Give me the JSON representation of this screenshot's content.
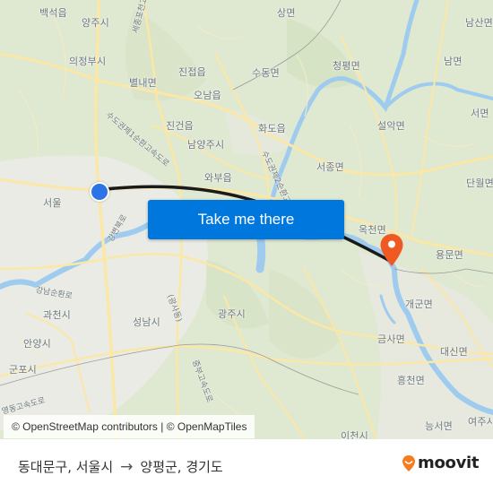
{
  "map": {
    "places": [
      {
        "name": "백석읍"
      },
      {
        "name": "양주시"
      },
      {
        "name": "의정부시"
      },
      {
        "name": "별내면"
      },
      {
        "name": "진접읍"
      },
      {
        "name": "오남읍"
      },
      {
        "name": "진건읍"
      },
      {
        "name": "남양주시"
      },
      {
        "name": "와부읍"
      },
      {
        "name": "서울"
      },
      {
        "name": "상면"
      },
      {
        "name": "수동면"
      },
      {
        "name": "청평면"
      },
      {
        "name": "남산면"
      },
      {
        "name": "남면"
      },
      {
        "name": "설악면"
      },
      {
        "name": "서면"
      },
      {
        "name": "화도읍"
      },
      {
        "name": "서종면"
      },
      {
        "name": "단월면"
      },
      {
        "name": "옥천면"
      },
      {
        "name": "용문면"
      },
      {
        "name": "개군면"
      },
      {
        "name": "금사면"
      },
      {
        "name": "대신면"
      },
      {
        "name": "흥천면"
      },
      {
        "name": "여주시"
      },
      {
        "name": "능서면"
      },
      {
        "name": "이천시"
      },
      {
        "name": "광주시"
      },
      {
        "name": "성남시"
      },
      {
        "name": "과천시"
      },
      {
        "name": "안양시"
      },
      {
        "name": "군포시"
      }
    ],
    "road_labels": [
      {
        "name": "세종포천고속도로"
      },
      {
        "name": "수도권제1순환고속도로"
      },
      {
        "name": "수도권제2순환고속도로"
      },
      {
        "name": "강남순환로"
      },
      {
        "name": "(광사동)"
      },
      {
        "name": "중부고속도로"
      },
      {
        "name": "영동고속도로"
      },
      {
        "name": "강변북로"
      }
    ],
    "origin_marker": {
      "label": "origin-location",
      "color": "#2b73e6"
    },
    "destination_marker": {
      "label": "destination-location",
      "color": "#f05a22"
    },
    "route_line_color": "#1a1a1a"
  },
  "cta": {
    "take_me_there_label": "Take me there",
    "color": "#0077dd"
  },
  "attribution": {
    "text": "© OpenStreetMap contributors | © OpenMapTiles"
  },
  "footer": {
    "origin": "동대문구, 서울시",
    "arrow": "→",
    "destination": "양평군, 경기도",
    "brand": "moovit",
    "brand_color": "#f57c1f"
  }
}
